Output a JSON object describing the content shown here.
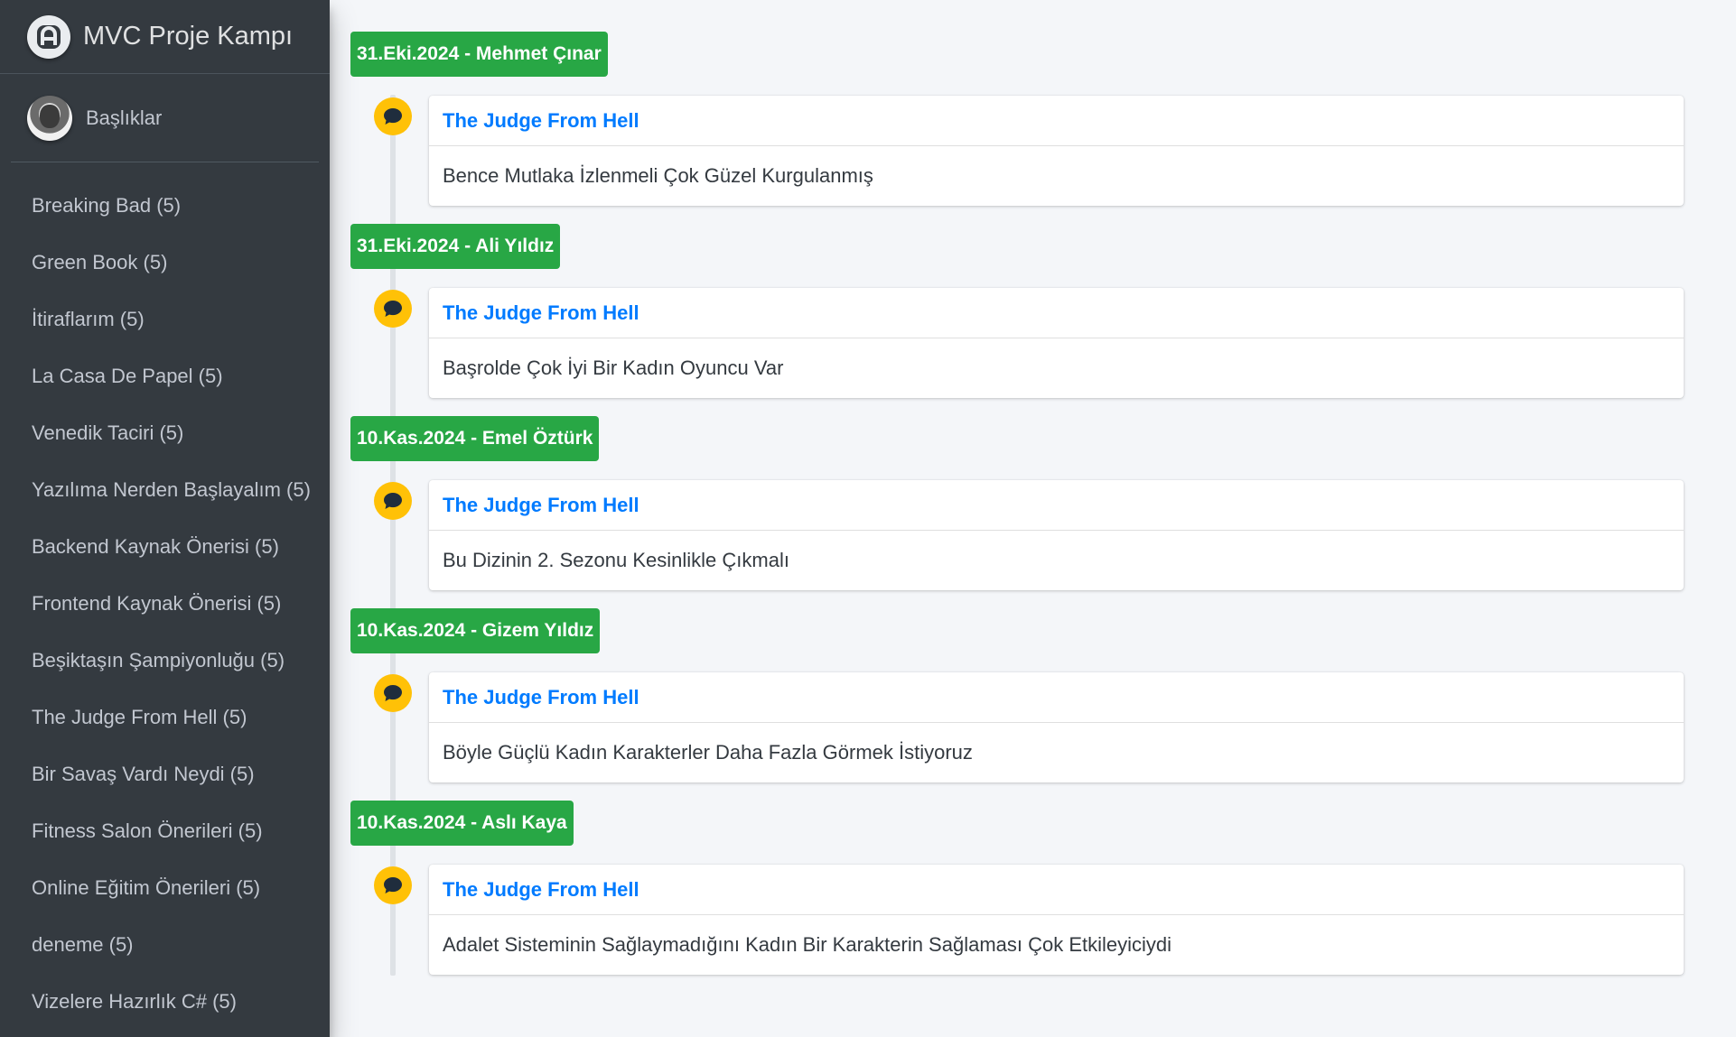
{
  "brand": {
    "title": "MVC Proje Kampı",
    "icon": "brand-logo-icon"
  },
  "user": {
    "name": "Başlıklar"
  },
  "sidebar": {
    "items": [
      {
        "label": "Breaking Bad (5)"
      },
      {
        "label": "Green Book (5)"
      },
      {
        "label": "İtiraflarım (5)"
      },
      {
        "label": "La Casa De Papel (5)"
      },
      {
        "label": "Venedik Taciri (5)"
      },
      {
        "label": "Yazılıma Nerden Başlayalım (5)"
      },
      {
        "label": "Backend Kaynak Önerisi (5)"
      },
      {
        "label": "Frontend Kaynak Önerisi (5)"
      },
      {
        "label": "Beşiktaşın Şampiyonluğu (5)"
      },
      {
        "label": "The Judge From Hell (5)"
      },
      {
        "label": "Bir Savaş Vardı Neydi (5)"
      },
      {
        "label": "Fitness Salon Önerileri (5)"
      },
      {
        "label": "Online Eğitim Önerileri (5)"
      },
      {
        "label": "deneme (5)"
      },
      {
        "label": "Vizelere Hazırlık C# (5)"
      }
    ]
  },
  "timeline": {
    "colors": {
      "label": "#28a745",
      "icon": "#ffc107",
      "link": "#007bff"
    },
    "entries": [
      {
        "label": "31.Eki.2024 - Mehmet Çınar",
        "title": "The Judge From Hell",
        "body": "Bence Mutlaka İzlenmeli Çok Güzel Kurgulanmış",
        "icon": "comment-icon"
      },
      {
        "label": "31.Eki.2024 - Ali Yıldız",
        "title": "The Judge From Hell",
        "body": "Başrolde Çok İyi Bir Kadın Oyuncu Var",
        "icon": "comment-icon"
      },
      {
        "label": "10.Kas.2024 - Emel Öztürk",
        "title": "The Judge From Hell",
        "body": "Bu Dizinin 2. Sezonu Kesinlikle Çıkmalı",
        "icon": "comment-icon"
      },
      {
        "label": "10.Kas.2024 - Gizem Yıldız",
        "title": "The Judge From Hell",
        "body": "Böyle Güçlü Kadın Karakterler Daha Fazla Görmek İstiyoruz",
        "icon": "comment-icon"
      },
      {
        "label": "10.Kas.2024 - Aslı Kaya",
        "title": "The Judge From Hell",
        "body": "Adalet Sisteminin Sağlaymadığını Kadın Bir Karakterin Sağlaması Çok Etkileyiciydi",
        "icon": "comment-icon"
      }
    ]
  }
}
